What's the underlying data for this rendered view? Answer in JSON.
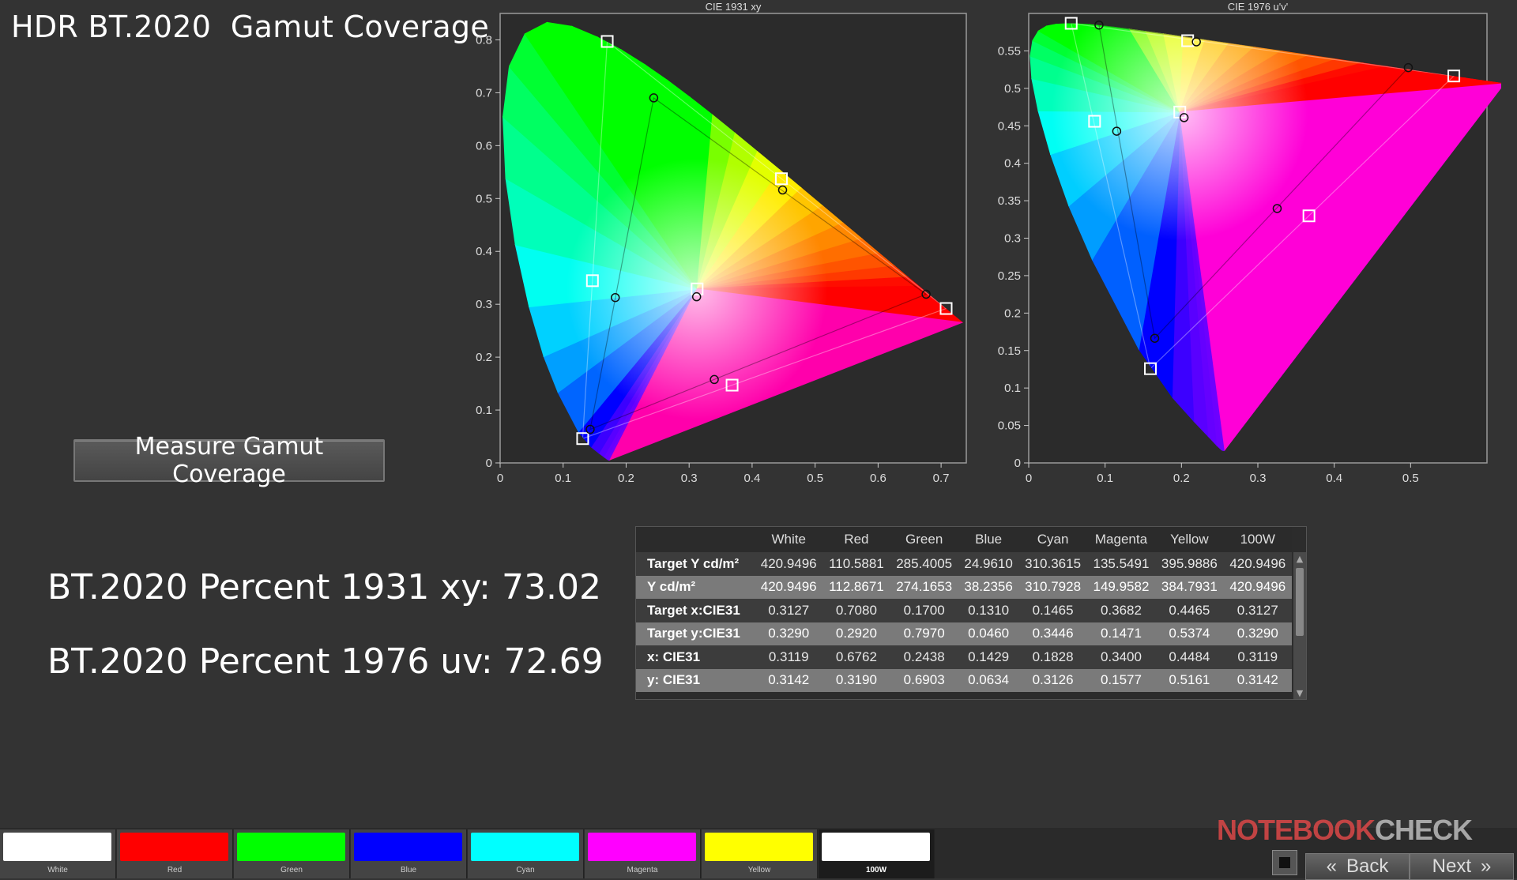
{
  "title": "HDR BT.2020  Gamut Coverage",
  "measure_button": "Measure Gamut Coverage",
  "percent_xy": "BT.2020 Percent 1931 xy: 73.02",
  "percent_uv": "BT.2020 Percent 1976 uv: 72.69",
  "chart_data": [
    {
      "type": "scatter",
      "title": "CIE 1931 xy",
      "xlim": [
        0,
        0.74
      ],
      "ylim": [
        0,
        0.85
      ],
      "x_ticks": [
        "0",
        "0.1",
        "0.2",
        "0.3",
        "0.4",
        "0.5",
        "0.6",
        "0.7"
      ],
      "y_ticks": [
        "0",
        "0.1",
        "0.2",
        "0.3",
        "0.4",
        "0.5",
        "0.6",
        "0.7",
        "0.8"
      ],
      "x_tick_values": [
        0,
        0.1,
        0.2,
        0.3,
        0.4,
        0.5,
        0.6,
        0.7
      ],
      "y_tick_values": [
        0,
        0.1,
        0.2,
        0.3,
        0.4,
        0.5,
        0.6,
        0.7,
        0.8
      ],
      "series": [
        {
          "points": [
            [
              0.3127,
              0.329
            ],
            [
              0.708,
              0.292
            ],
            [
              0.17,
              0.797
            ],
            [
              0.131,
              0.046
            ],
            [
              0.1465,
              0.3446
            ],
            [
              0.3682,
              0.1471
            ],
            [
              0.4465,
              0.5374
            ]
          ]
        },
        {
          "points": [
            [
              0.3119,
              0.3142
            ],
            [
              0.6762,
              0.319
            ],
            [
              0.2438,
              0.6903
            ],
            [
              0.1429,
              0.0634
            ],
            [
              0.1828,
              0.3126
            ],
            [
              0.34,
              0.1577
            ],
            [
              0.4484,
              0.5161
            ]
          ]
        }
      ]
    },
    {
      "type": "scatter",
      "title": "CIE 1976 u'v'",
      "xlim": [
        0,
        0.6
      ],
      "ylim": [
        0,
        0.6
      ],
      "x_ticks": [
        "0",
        "0.1",
        "0.2",
        "0.3",
        "0.4",
        "0.5"
      ],
      "y_ticks": [
        "0",
        "0.05",
        "0.1",
        "0.15",
        "0.2",
        "0.25",
        "0.3",
        "0.35",
        "0.4",
        "0.45",
        "0.5",
        "0.55"
      ],
      "x_tick_values": [
        0,
        0.1,
        0.2,
        0.3,
        0.4,
        0.5
      ],
      "y_tick_values": [
        0,
        0.05,
        0.1,
        0.15,
        0.2,
        0.25,
        0.3,
        0.35,
        0.4,
        0.45,
        0.5,
        0.55
      ],
      "series": [
        {
          "points": [
            [
              0.1978,
              0.4683
            ],
            [
              0.5566,
              0.5165
            ],
            [
              0.0556,
              0.5868
            ],
            [
              0.1593,
              0.1258
            ],
            [
              0.0862,
              0.456
            ],
            [
              0.3669,
              0.3298
            ],
            [
              0.2081,
              0.5636
            ]
          ]
        },
        {
          "points": [
            [
              0.2034,
              0.4609
            ],
            [
              0.497,
              0.5277
            ],
            [
              0.092,
              0.5845
            ],
            [
              0.165,
              0.1664
            ],
            [
              0.1152,
              0.4428
            ],
            [
              0.3253,
              0.3396
            ],
            [
              0.2195,
              0.5621
            ]
          ]
        }
      ]
    }
  ],
  "table": {
    "columns": [
      "",
      "White",
      "Red",
      "Green",
      "Blue",
      "Cyan",
      "Magenta",
      "Yellow",
      "100W"
    ],
    "rows": [
      {
        "label": "Target Y cd/m²",
        "values": [
          "420.9496",
          "110.5881",
          "285.4005",
          "24.9610",
          "310.3615",
          "135.5491",
          "395.9886",
          "420.9496"
        ]
      },
      {
        "label": "Y cd/m²",
        "values": [
          "420.9496",
          "112.8671",
          "274.1653",
          "38.2356",
          "310.7928",
          "149.9582",
          "384.7931",
          "420.9496"
        ]
      },
      {
        "label": "Target x:CIE31",
        "values": [
          "0.3127",
          "0.7080",
          "0.1700",
          "0.1310",
          "0.1465",
          "0.3682",
          "0.4465",
          "0.3127"
        ]
      },
      {
        "label": "Target y:CIE31",
        "values": [
          "0.3290",
          "0.2920",
          "0.7970",
          "0.0460",
          "0.3446",
          "0.1471",
          "0.5374",
          "0.3290"
        ]
      },
      {
        "label": "x: CIE31",
        "values": [
          "0.3119",
          "0.6762",
          "0.2438",
          "0.1429",
          "0.1828",
          "0.3400",
          "0.4484",
          "0.3119"
        ]
      },
      {
        "label": "y: CIE31",
        "values": [
          "0.3142",
          "0.3190",
          "0.6903",
          "0.0634",
          "0.3126",
          "0.1577",
          "0.5161",
          "0.3142"
        ]
      }
    ]
  },
  "palette": [
    {
      "label": "White",
      "color": "#ffffff"
    },
    {
      "label": "Red",
      "color": "#ff0000"
    },
    {
      "label": "Green",
      "color": "#00ff00"
    },
    {
      "label": "Blue",
      "color": "#0000ff"
    },
    {
      "label": "Cyan",
      "color": "#00ffff"
    },
    {
      "label": "Magenta",
      "color": "#ff00ff"
    },
    {
      "label": "Yellow",
      "color": "#ffff00"
    },
    {
      "label": "100W",
      "color": "#ffffff",
      "selected": true
    }
  ],
  "watermark": {
    "main": "NOTEBOOK",
    "tail": "CHECK"
  },
  "nav": {
    "back": "Back",
    "next": "Next",
    "back_icon": "double-chevron-left-icon",
    "next_icon": "double-chevron-right-icon"
  }
}
